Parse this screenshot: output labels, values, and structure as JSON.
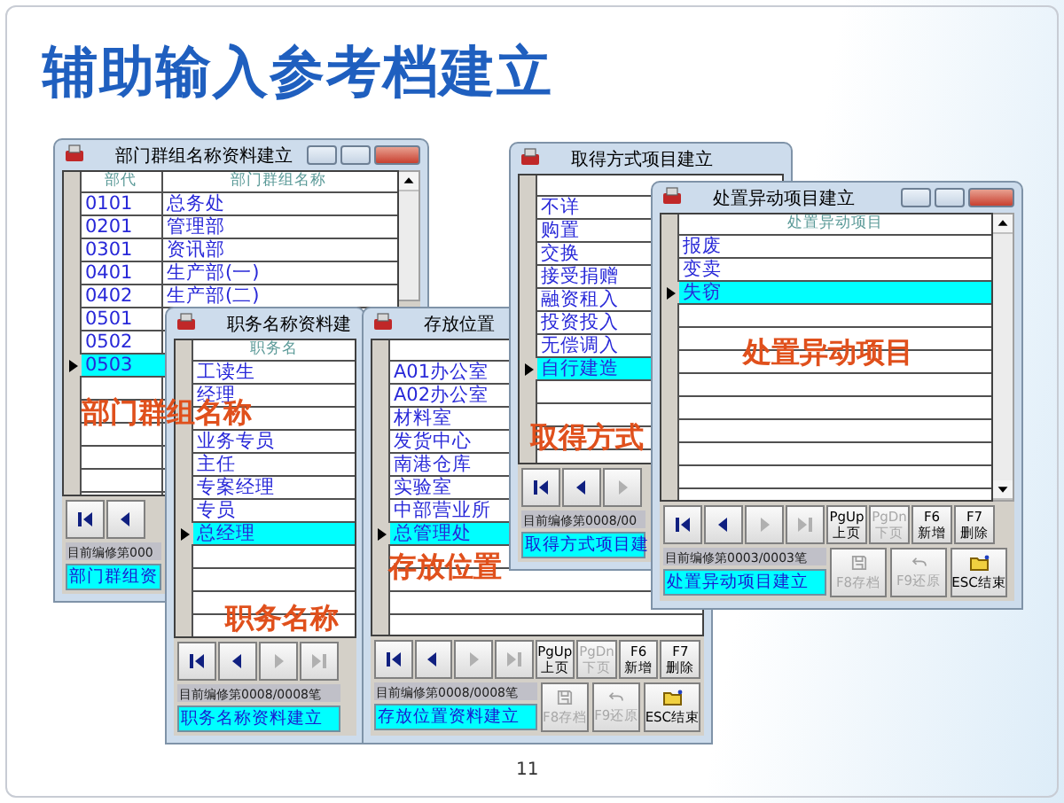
{
  "slide": {
    "title": "辅助输入参考档建立",
    "page_number": "11"
  },
  "windows": [
    {
      "title": "部门群组名称资料建立",
      "controls": true,
      "scrollbar": true,
      "columns": [
        "部代",
        "部门群组名称"
      ],
      "rows": [
        {
          "cells": [
            "0101",
            "总务处"
          ],
          "selected": false
        },
        {
          "cells": [
            "0201",
            "管理部"
          ],
          "selected": false
        },
        {
          "cells": [
            "0301",
            "资讯部"
          ],
          "selected": false
        },
        {
          "cells": [
            "0401",
            "生产部(一)"
          ],
          "selected": false
        },
        {
          "cells": [
            "0402",
            "生产部(二)"
          ],
          "selected": false
        },
        {
          "cells": [
            "0501"
          ],
          "selected": false
        },
        {
          "cells": [
            "0502"
          ],
          "selected": false
        },
        {
          "cells": [
            "0503"
          ],
          "selected": true
        }
      ],
      "nav": [
        {
          "kind": "first",
          "disabled": false
        },
        {
          "kind": "prev",
          "disabled": false
        }
      ],
      "status": "目前编修第000",
      "caption": "部门群组资"
    },
    {
      "title": "职务名称资料建",
      "controls": false,
      "scrollbar": false,
      "columns": [
        "职务名"
      ],
      "rows": [
        {
          "cells": [
            "工读生"
          ],
          "selected": false
        },
        {
          "cells": [
            "经理"
          ],
          "selected": false
        },
        {
          "selected": false
        },
        {
          "cells": [
            "业务专员"
          ],
          "selected": false
        },
        {
          "cells": [
            "主任"
          ],
          "selected": false
        },
        {
          "cells": [
            "专案经理"
          ],
          "selected": false
        },
        {
          "cells": [
            "专员"
          ],
          "selected": false
        },
        {
          "cells": [
            "总经理"
          ],
          "selected": true
        }
      ],
      "nav": [
        {
          "kind": "first",
          "disabled": false
        },
        {
          "kind": "prev",
          "disabled": false
        },
        {
          "kind": "next",
          "disabled": true
        },
        {
          "kind": "last",
          "disabled": true
        }
      ],
      "status": "目前编修第0008/0008笔",
      "caption": "职务名称资料建立"
    },
    {
      "title": "存放位置",
      "controls": false,
      "scrollbar": false,
      "rows": [
        {
          "cells": [
            "A01办公室"
          ],
          "selected": false
        },
        {
          "cells": [
            "A02办公室"
          ],
          "selected": false
        },
        {
          "cells": [
            "材料室"
          ],
          "selected": false
        },
        {
          "cells": [
            "发货中心"
          ],
          "selected": false
        },
        {
          "cells": [
            "南港仓库"
          ],
          "selected": false
        },
        {
          "cells": [
            "实验室"
          ],
          "selected": false
        },
        {
          "cells": [
            "中部营业所"
          ],
          "selected": false
        },
        {
          "cells": [
            "总管理处"
          ],
          "selected": true
        }
      ],
      "nav": [
        {
          "kind": "first",
          "disabled": false
        },
        {
          "kind": "prev",
          "disabled": false
        },
        {
          "kind": "next",
          "disabled": true
        },
        {
          "kind": "last",
          "disabled": true
        }
      ],
      "keys": [
        {
          "key": "PgUp",
          "label": "上页",
          "disabled": false
        },
        {
          "key": "PgDn",
          "label": "下页",
          "disabled": true
        },
        {
          "key": "F6",
          "label": "新增",
          "disabled": false
        },
        {
          "key": "F7",
          "label": "删除",
          "disabled": false
        }
      ],
      "status": "目前编修第0008/0008笔",
      "caption": "存放位置资料建立",
      "actions": [
        {
          "kind": "save",
          "label": "F8存档",
          "disabled": true
        },
        {
          "kind": "undo",
          "label": "F9还原",
          "disabled": true
        },
        {
          "kind": "exit",
          "label": "ESC结束",
          "disabled": false
        }
      ]
    },
    {
      "title": "取得方式项目建立",
      "controls": false,
      "scrollbar": false,
      "rows": [
        {
          "cells": [
            "不详"
          ],
          "selected": false
        },
        {
          "cells": [
            "购置"
          ],
          "selected": false
        },
        {
          "cells": [
            "交换"
          ],
          "selected": false
        },
        {
          "cells": [
            "接受捐赠"
          ],
          "selected": false
        },
        {
          "cells": [
            "融资租入"
          ],
          "selected": false
        },
        {
          "cells": [
            "投资投入"
          ],
          "selected": false
        },
        {
          "cells": [
            "无偿调入"
          ],
          "selected": false
        },
        {
          "cells": [
            "自行建造"
          ],
          "selected": true
        }
      ],
      "nav": [
        {
          "kind": "first",
          "disabled": false
        },
        {
          "kind": "prev",
          "disabled": false
        },
        {
          "kind": "next",
          "disabled": true
        }
      ],
      "status": "目前编修第0008/00",
      "caption": "取得方式项目建"
    },
    {
      "title": "处置异动项目建立",
      "controls": true,
      "scrollbar": true,
      "columns": [
        "处置异动项目"
      ],
      "rows": [
        {
          "cells": [
            "报废"
          ],
          "selected": false
        },
        {
          "cells": [
            "变卖"
          ],
          "selected": false
        },
        {
          "cells": [
            "失窃"
          ],
          "selected": true
        }
      ],
      "nav": [
        {
          "kind": "first",
          "disabled": false
        },
        {
          "kind": "prev",
          "disabled": false
        },
        {
          "kind": "next",
          "disabled": true
        },
        {
          "kind": "last",
          "disabled": true
        }
      ],
      "keys": [
        {
          "key": "PgUp",
          "label": "上页",
          "disabled": false
        },
        {
          "key": "PgDn",
          "label": "下页",
          "disabled": true
        },
        {
          "key": "F6",
          "label": "新增",
          "disabled": false
        },
        {
          "key": "F7",
          "label": "删除",
          "disabled": false
        }
      ],
      "status": "目前编修第0003/0003笔",
      "caption": "处置异动项目建立",
      "actions": [
        {
          "kind": "save",
          "label": "F8存档",
          "disabled": true
        },
        {
          "kind": "undo",
          "label": "F9还原",
          "disabled": true
        },
        {
          "kind": "exit",
          "label": "ESC结束",
          "disabled": false
        }
      ]
    }
  ],
  "annotations": [
    "部门群组名称",
    "职务名称",
    "存放位置",
    "取得方式",
    "处置异动项目"
  ]
}
